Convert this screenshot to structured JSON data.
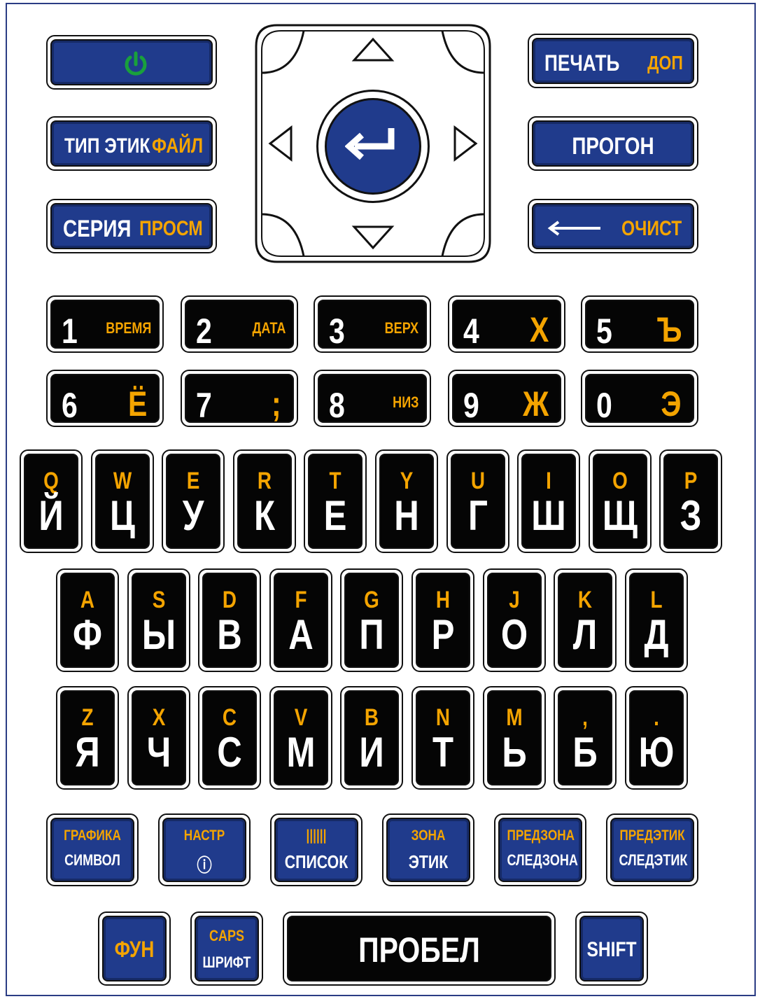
{
  "colors": {
    "blue": "#203b8c",
    "black": "#050505",
    "label_white": "#ffffff",
    "label_yellow": "#f4a400",
    "power_green": "#19a03c",
    "frame": "#2b3c84"
  },
  "left_keys": [
    {
      "icon": "power-icon"
    },
    {
      "main": "ТИП ЭТИК",
      "alt": "ФАЙЛ"
    },
    {
      "main": "СЕРИЯ",
      "alt": "ПРОСМ"
    }
  ],
  "right_keys": [
    {
      "main": "ПЕЧАТЬ",
      "alt": "ДОП"
    },
    {
      "main": "ПРОГОН"
    },
    {
      "icon": "backspace-arrow-icon",
      "alt": "ОЧИСТ"
    }
  ],
  "dpad": {
    "icons": [
      "up-arrow-icon",
      "down-arrow-icon",
      "left-arrow-icon",
      "right-arrow-icon",
      "enter-icon"
    ]
  },
  "number_rows": [
    [
      {
        "n": "1",
        "s": "ВРЕМЯ"
      },
      {
        "n": "2",
        "s": "ДАТА"
      },
      {
        "n": "3",
        "s": "ВЕРХ"
      },
      {
        "n": "4",
        "b": "Х"
      },
      {
        "n": "5",
        "b": "Ъ"
      }
    ],
    [
      {
        "n": "6",
        "b": "Ё"
      },
      {
        "n": "7",
        "b": ";"
      },
      {
        "n": "8",
        "s": "НИЗ"
      },
      {
        "n": "9",
        "b": "Ж"
      },
      {
        "n": "0",
        "b": "Э"
      }
    ]
  ],
  "letter_rows": [
    [
      {
        "t": "Q",
        "m": "Й"
      },
      {
        "t": "W",
        "m": "Ц"
      },
      {
        "t": "E",
        "m": "У"
      },
      {
        "t": "R",
        "m": "К"
      },
      {
        "t": "T",
        "m": "Е"
      },
      {
        "t": "Y",
        "m": "Н"
      },
      {
        "t": "U",
        "m": "Г"
      },
      {
        "t": "I",
        "m": "Ш"
      },
      {
        "t": "O",
        "m": "Щ"
      },
      {
        "t": "P",
        "m": "З"
      }
    ],
    [
      {
        "t": "A",
        "m": "Ф"
      },
      {
        "t": "S",
        "m": "Ы"
      },
      {
        "t": "D",
        "m": "В"
      },
      {
        "t": "F",
        "m": "А"
      },
      {
        "t": "G",
        "m": "П"
      },
      {
        "t": "H",
        "m": "Р"
      },
      {
        "t": "J",
        "m": "О"
      },
      {
        "t": "K",
        "m": "Л"
      },
      {
        "t": "L",
        "m": "Д"
      }
    ],
    [
      {
        "t": "Z",
        "m": "Я"
      },
      {
        "t": "X",
        "m": "Ч"
      },
      {
        "t": "C",
        "m": "С"
      },
      {
        "t": "V",
        "m": "М"
      },
      {
        "t": "B",
        "m": "И"
      },
      {
        "t": "N",
        "m": "Т"
      },
      {
        "t": "M",
        "m": "Ь"
      },
      {
        "t": ",",
        "m": "Б"
      },
      {
        "t": ".",
        "m": "Ю"
      }
    ]
  ],
  "function_row": [
    {
      "t": "ГРАФИКА",
      "m": "СИМВОЛ",
      "ty": true
    },
    {
      "t": "НАСТР",
      "icon": "info-icon",
      "m": "ⓘ"
    },
    {
      "t": "||||||",
      "m": "СПИСОК",
      "icon": "barcode-icon"
    },
    {
      "t": "ЗОНА",
      "m": "ЭТИК"
    },
    {
      "t": "ПРЕДЗОНА",
      "m": "СЛЕДЗОНА"
    },
    {
      "t": "ПРЕДЭТИК",
      "m": "СЛЕДЭТИК"
    }
  ],
  "bottom_row": {
    "fun": "ФУН",
    "caps": "CAPS",
    "font": "ШРИФТ",
    "space": "ПРОБЕЛ",
    "shift": "SHIFT"
  }
}
